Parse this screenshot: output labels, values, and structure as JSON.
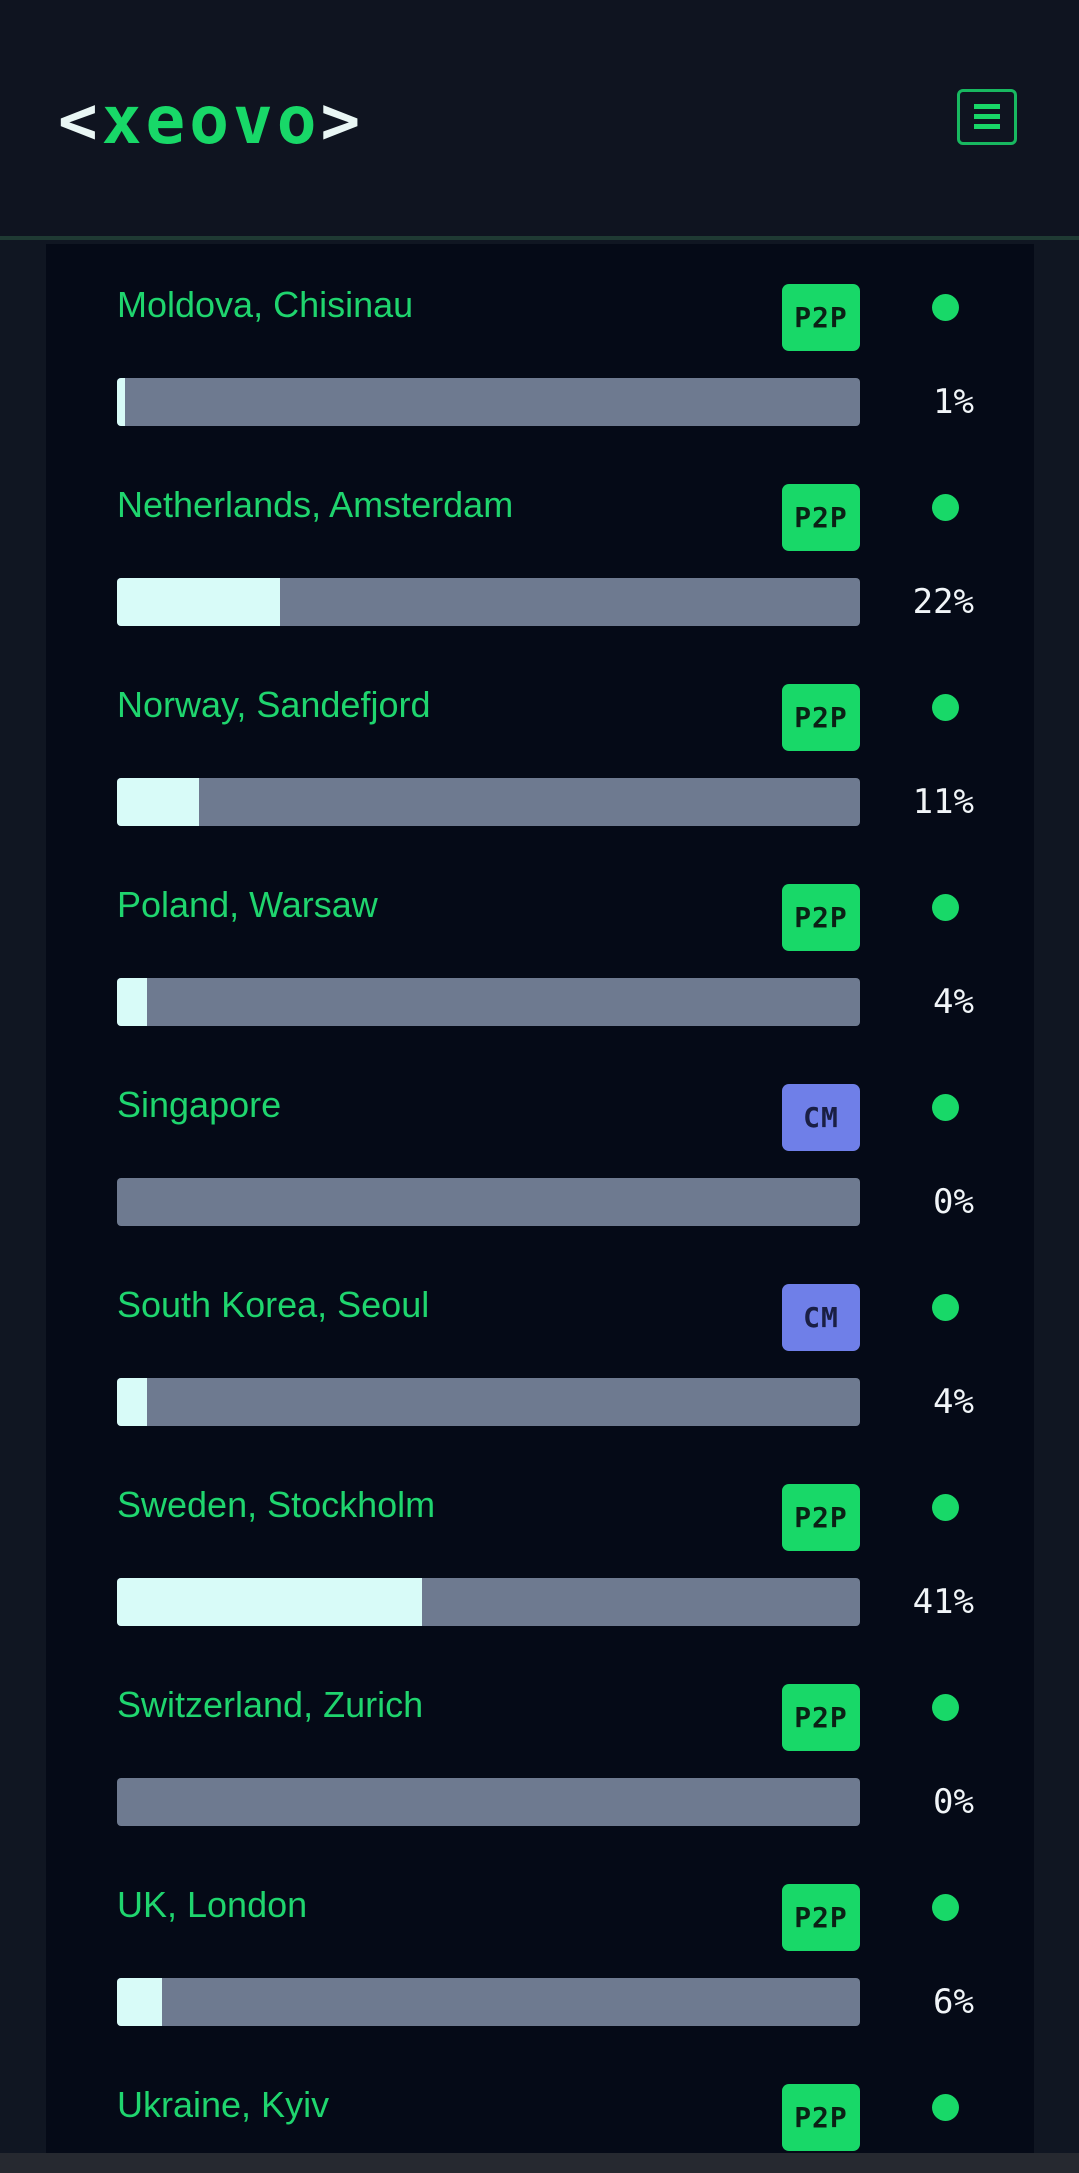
{
  "header": {
    "logo_left_bracket": "<",
    "logo_text": "xeovo",
    "logo_right_bracket": ">",
    "menu_icon": "hamburger-menu-icon",
    "colors": {
      "accent": "#18d868",
      "background": "#0f1420"
    }
  },
  "servers": [
    {
      "location": "Moldova, Chisinau",
      "type": "P2P",
      "load_percent": 1,
      "load_label": "1%",
      "status": "online"
    },
    {
      "location": "Netherlands, Amsterdam",
      "type": "P2P",
      "load_percent": 22,
      "load_label": "22%",
      "status": "online"
    },
    {
      "location": "Norway, Sandefjord",
      "type": "P2P",
      "load_percent": 11,
      "load_label": "11%",
      "status": "online"
    },
    {
      "location": "Poland, Warsaw",
      "type": "P2P",
      "load_percent": 4,
      "load_label": "4%",
      "status": "online"
    },
    {
      "location": "Singapore",
      "type": "CM",
      "load_percent": 0,
      "load_label": "0%",
      "status": "online"
    },
    {
      "location": "South Korea, Seoul",
      "type": "CM",
      "load_percent": 4,
      "load_label": "4%",
      "status": "online"
    },
    {
      "location": "Sweden, Stockholm",
      "type": "P2P",
      "load_percent": 41,
      "load_label": "41%",
      "status": "online"
    },
    {
      "location": "Switzerland, Zurich",
      "type": "P2P",
      "load_percent": 0,
      "load_label": "0%",
      "status": "online"
    },
    {
      "location": "UK, London",
      "type": "P2P",
      "load_percent": 6,
      "load_label": "6%",
      "status": "online"
    },
    {
      "location": "Ukraine, Kyiv",
      "type": "P2P",
      "status": "online"
    }
  ],
  "colors": {
    "p2p_badge": "#18d868",
    "cm_badge": "#6f7fe8",
    "status_online": "#18d868",
    "bar_track": "#6e7a90",
    "bar_fill": "#d8fbf8",
    "location_text": "#1fd56e"
  }
}
